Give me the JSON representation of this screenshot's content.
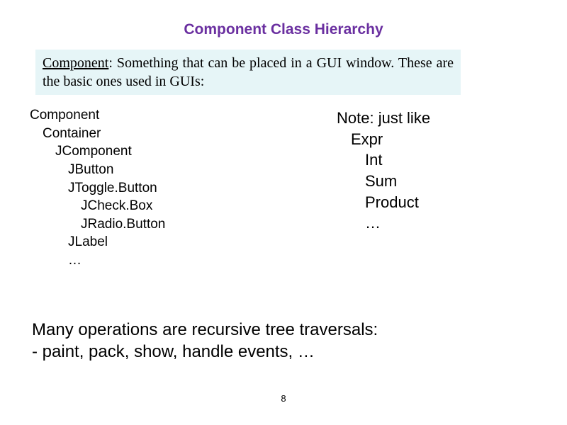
{
  "title": "Component Class Hierarchy",
  "definition": {
    "term": "Component",
    "rest": ":  Something  that  can  be  placed  in  a  GUI window.  These are the basic ones used in GUIs:"
  },
  "leftTree": {
    "l0": "Component",
    "l1": "Container",
    "l2": "JComponent",
    "l3a": "JButton",
    "l3b": "JToggle.Button",
    "l4a": "JCheck.Box",
    "l4b": "JRadio.Button",
    "l3c": "JLabel",
    "l3d": "…"
  },
  "rightTree": {
    "r0": "Note: just like",
    "r1a": "Expr",
    "r2a": "Int",
    "r2b": "Sum",
    "r2c": "Product",
    "r2d": "…"
  },
  "bottom": {
    "line1": "Many operations are recursive tree traversals:",
    "line2": " - paint, pack, show, handle events, …"
  },
  "pageNumber": "8"
}
